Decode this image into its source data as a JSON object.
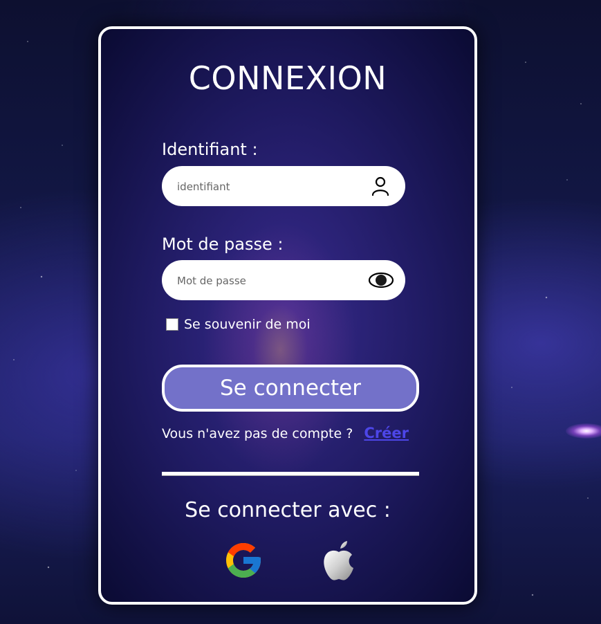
{
  "login": {
    "title": "CONNEXION",
    "username_label": "Identifiant :",
    "username_placeholder": "identifiant",
    "password_label": "Mot de passe :",
    "password_placeholder": "Mot de passe",
    "remember_label": "Se souvenir de moi",
    "submit_label": "Se connecter",
    "no_account_text": "Vous n'avez pas de compte ?",
    "create_link": "Créer",
    "social_title": "Se connecter avec :"
  },
  "icons": {
    "username": "user-icon",
    "password": "eye-icon",
    "google": "google-icon",
    "apple": "apple-icon"
  },
  "colors": {
    "button": "#7371c9",
    "link": "#4d46e8"
  }
}
